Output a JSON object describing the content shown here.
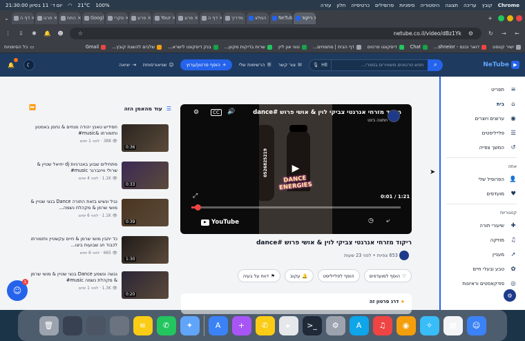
{
  "menubar": {
    "left": [
      "Chrome",
      "קובץ",
      "עריכה",
      "תצוגה",
      "היסטוריה",
      "סימניות",
      "פרופילים",
      "כרטיסייה",
      "חלון",
      "עזרה"
    ],
    "battery": "100%",
    "temperature": "21°C",
    "datetime": "יום ד׳ 11 בסיוון 21:30:00"
  },
  "tabs": [
    {
      "label": "ריקוד",
      "color": "#2563eb",
      "active": true
    },
    {
      "label": "NeTub",
      "color": "#2563eb"
    },
    {
      "label": "המלצ",
      "color": "#2563eb"
    },
    {
      "label": "מדריך",
      "color": "#9ca3af"
    },
    {
      "label": "דף ה",
      "color": "#9ca3af"
    },
    {
      "label": "פרוג",
      "color": "#9ca3af"
    },
    {
      "label": "Your",
      "color": "#9ca3af"
    },
    {
      "label": "פרוג",
      "color": "#9ca3af"
    },
    {
      "label": "סקרי",
      "color": "#9ca3af"
    },
    {
      "label": "Googl",
      "color": "#9ca3af"
    },
    {
      "label": "התח",
      "color": "#9ca3af"
    },
    {
      "label": "תרגו",
      "color": "#9ca3af"
    },
    {
      "label": "דף ה",
      "color": "#9ca3af"
    }
  ],
  "address": {
    "url": "netube.co.il/video/dBz1Yk"
  },
  "bookmarks": [
    {
      "label": "ישיר קטסט",
      "color": "#9ca3af"
    },
    {
      "label": "דואר נכנס - shneior...",
      "color": "#ef4444"
    },
    {
      "label": "Chat",
      "color": "#16a34a"
    },
    {
      "label": "דיסקונט פרטים",
      "color": "#22c55e"
    },
    {
      "label": "דף הבית | מתמחים...",
      "color": "#9ca3af"
    },
    {
      "label": "טוני און ליין",
      "color": "#16a34a"
    },
    {
      "label": "שרות בדיקות מקוון...",
      "color": "#22c55e"
    },
    {
      "label": "בנק דיסקונט לישרא...",
      "color": "#16a34a"
    },
    {
      "label": "שלבים להשגת קובץ...",
      "color": "#f59e0b"
    },
    {
      "label": "Gmail",
      "color": "#ef4444"
    }
  ],
  "bookmarks_all": "כל הסימניות",
  "header": {
    "logo": "NeTube",
    "search_placeholder": "חפש סרטונים משאירים בספרי...",
    "lang": "HE",
    "nav": [
      "צור קשר",
      "הרשימות שלי"
    ],
    "upload": "הוסף סרטון/ערוץ",
    "user": "שניאורסוחת",
    "logout": "יציאה"
  },
  "sidebar": {
    "main": [
      {
        "label": "תפריט",
        "icon": "≡"
      },
      {
        "label": "בית",
        "icon": "⌂"
      },
      {
        "label": "ערוצים ויוצרים",
        "icon": "◉"
      },
      {
        "label": "פלייליסטים",
        "icon": "☰"
      },
      {
        "label": "המשך צפייה",
        "icon": "↺"
      }
    ],
    "section_you": "אתה",
    "you": [
      {
        "label": "הפרופיל שלי",
        "icon": "👤"
      },
      {
        "label": "מועדפים",
        "icon": "♥"
      }
    ],
    "section_cat": "קטגוריות",
    "cats": [
      {
        "label": "שיעורי תורה",
        "icon": "✚"
      },
      {
        "label": "מוזיקה",
        "icon": "♫"
      },
      {
        "label": "מעניין",
        "icon": "➚"
      },
      {
        "label": "טבע ובעלי חיים",
        "icon": "✿"
      },
      {
        "label": "פודקאסטים וראיונות",
        "icon": "◎"
      }
    ]
  },
  "player": {
    "title": "ריקוד מזרחי אנרגטי צביקי לוין & אושי פרוש #dance",
    "channel": "חתונה בינט",
    "time": "0:01 / 1:21",
    "progress": 0.03,
    "brand": "YouTube",
    "overlay_text": "DANCE ENERGIES",
    "phone": "0526825219"
  },
  "video": {
    "title": "ריקוד מזרחי אנרגטי צביקי לוין & אושי פרוש #dance",
    "views": "653 צפיות",
    "ago": "לפני 23 שעות",
    "actions": [
      "הוסף למועדפים",
      "הוסף לפלייליסט",
      "עקוב",
      "דווח על בעיה"
    ],
    "rate_title": "דרג סרטון זה"
  },
  "related": {
    "title": "עוד מהאמן הזה",
    "items": [
      {
        "title": "חסידיש טאנץ יהודה מנחים & נחמן באמטון ותזמורתו &music#",
        "views": "388",
        "ago": "לפני 1 ימים",
        "dur": "0:36",
        "color": "#2a2520"
      },
      {
        "title": "מתחילים שבוע באנרגיות dj יחיאל שטיין & שרולי וויינברגר music#",
        "views": "1.1K",
        "ago": "לפני 4 ימים",
        "dur": "0:33",
        "color": "#3b2a55"
      },
      {
        "title": "נגיל ונשיש בזאת התורה Dance בנצי שטיין & מושי שרמן & מקהלת נשמה...",
        "views": "1.1K",
        "ago": "לפני 6 ימים",
        "dur": "0:39",
        "color": "#4a3520"
      },
      {
        "title": "כד יתבין מושי שרמן & חיים עקשטיין ותזמורתו לכבוד חג שבועות ביצו...",
        "views": "665",
        "ago": "לפני 6 ימים",
        "dur": "1:30",
        "color": "#1f1a18"
      },
      {
        "title": "נגשה ונשמע Dance בנצי שטיין & מושי שרמן & מקהלת נשמה music#",
        "views": "1.3K",
        "ago": "לפני 1 ימים",
        "dur": "0:20",
        "color": "#2b2536"
      }
    ]
  },
  "chat_badge": "1",
  "dock": [
    {
      "name": "trash",
      "color": "#9ca3af",
      "glyph": "🗑"
    },
    {
      "name": "window-1",
      "color": "#374151",
      "glyph": ""
    },
    {
      "name": "window-2",
      "color": "#4b5563",
      "glyph": ""
    },
    {
      "name": "window-3",
      "color": "#6b7280",
      "glyph": ""
    },
    {
      "name": "notes",
      "color": "#facc15",
      "glyph": "≡"
    },
    {
      "name": "whatsapp",
      "color": "#22c55e",
      "glyph": "✆"
    },
    {
      "name": "copilot",
      "color": "#60a5fa",
      "glyph": "✦"
    },
    {
      "name": "sep",
      "color": "",
      "glyph": ""
    },
    {
      "name": "appstore",
      "color": "#3b82f6",
      "glyph": "A"
    },
    {
      "name": "setapp",
      "color": "#a855f7",
      "glyph": "+"
    },
    {
      "name": "whatsapp-business",
      "color": "#facc15",
      "glyph": "✆"
    },
    {
      "name": "bitdefender",
      "color": "#e5e7eb",
      "glyph": "▸"
    },
    {
      "name": "terminal",
      "color": "#1f2937",
      "glyph": ">_"
    },
    {
      "name": "settings",
      "color": "#9ca3af",
      "glyph": "⚙"
    },
    {
      "name": "app-store",
      "color": "#0ea5e9",
      "glyph": "A"
    },
    {
      "name": "music",
      "color": "#ef4444",
      "glyph": "♫"
    },
    {
      "name": "chrome",
      "color": "#f59e0b",
      "glyph": "◉"
    },
    {
      "name": "safari",
      "color": "#38bdf8",
      "glyph": "✧"
    },
    {
      "name": "launchpad",
      "color": "#f3f4f6",
      "glyph": "▦"
    },
    {
      "name": "finder",
      "color": "#3b82f6",
      "glyph": "☺"
    }
  ]
}
